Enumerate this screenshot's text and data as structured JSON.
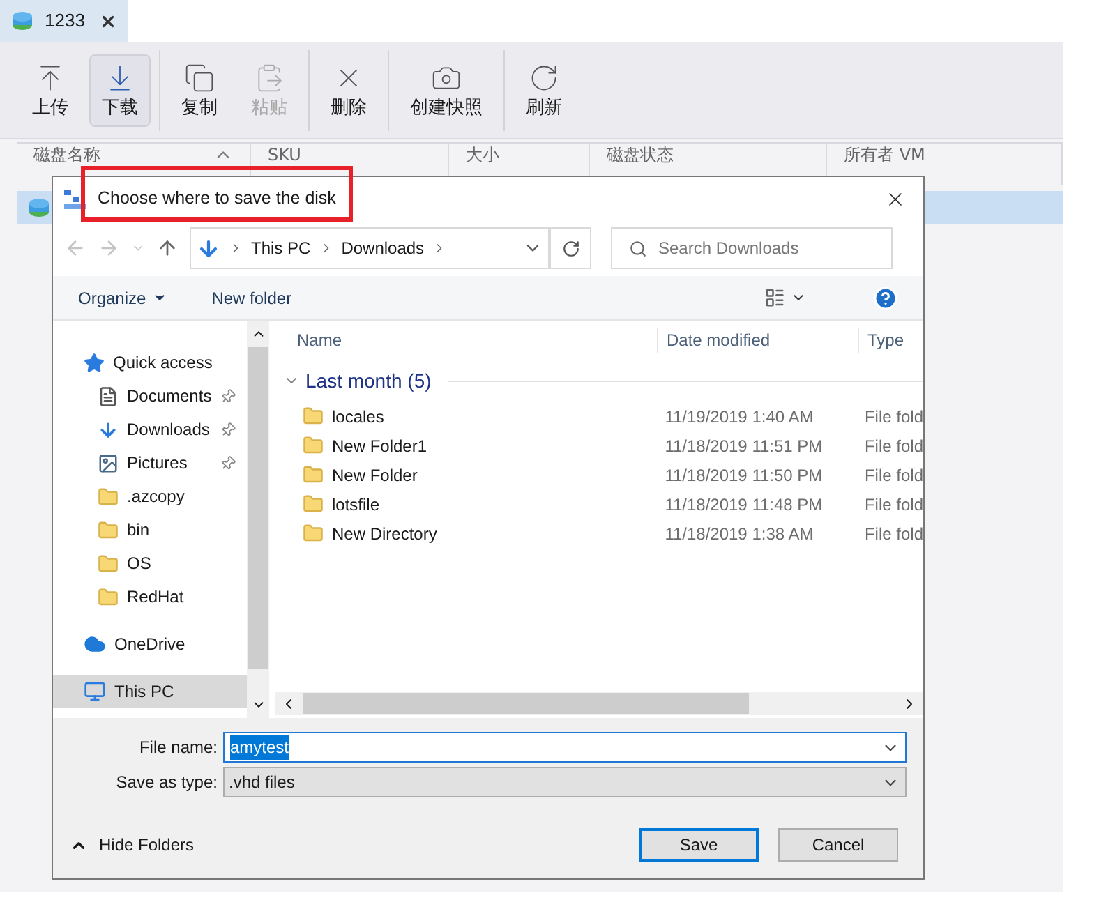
{
  "app": {
    "tab": {
      "title": "1233",
      "selected": true
    },
    "toolbar": [
      {
        "buttons": [
          {
            "kind": "upload",
            "label": "上传",
            "selected": false,
            "disabled": false
          },
          {
            "kind": "download",
            "label": "下载",
            "selected": true,
            "disabled": false
          }
        ]
      },
      {
        "buttons": [
          {
            "kind": "copy",
            "label": "复制",
            "selected": false,
            "disabled": false
          },
          {
            "kind": "paste",
            "label": "粘贴",
            "selected": false,
            "disabled": true
          }
        ]
      },
      {
        "buttons": [
          {
            "kind": "delete",
            "label": "删除",
            "selected": false,
            "disabled": false
          }
        ]
      },
      {
        "buttons": [
          {
            "kind": "snapshot",
            "label": "创建快照",
            "selected": false,
            "disabled": false
          }
        ]
      },
      {
        "buttons": [
          {
            "kind": "refresh",
            "label": "刷新",
            "selected": false,
            "disabled": false
          }
        ]
      }
    ],
    "table": {
      "columns": [
        {
          "label": "磁盘名称",
          "sorted": true
        },
        {
          "label": "SKU",
          "sorted": false
        },
        {
          "label": "大小",
          "sorted": false
        },
        {
          "label": "磁盘状态",
          "sorted": false
        },
        {
          "label": "所有者 VM",
          "sorted": false
        }
      ],
      "rows": [
        {
          "selected": true
        }
      ]
    }
  },
  "dialog": {
    "title": "Choose where to save the disk",
    "highlighted": true,
    "address": {
      "path": [
        "This PC",
        "Downloads"
      ]
    },
    "search": {
      "placeholder": "Search Downloads"
    },
    "commands": {
      "organize": "Organize",
      "new_folder": "New folder"
    },
    "nav": [
      {
        "kind": "quick_access",
        "label": "Quick access",
        "selected": false,
        "children": [
          {
            "kind": "documents",
            "label": "Documents",
            "pinned": true,
            "selected": false
          },
          {
            "kind": "downloads",
            "label": "Downloads",
            "pinned": true,
            "selected": false
          },
          {
            "kind": "pictures",
            "label": "Pictures",
            "pinned": true,
            "selected": false
          },
          {
            "kind": "folder",
            "label": ".azcopy",
            "pinned": false,
            "selected": false
          },
          {
            "kind": "folder",
            "label": "bin",
            "pinned": false,
            "selected": false
          },
          {
            "kind": "folder",
            "label": "OS",
            "pinned": false,
            "selected": false
          },
          {
            "kind": "folder",
            "label": "RedHat",
            "pinned": false,
            "selected": false
          }
        ]
      },
      {
        "kind": "onedrive",
        "label": "OneDrive",
        "selected": false
      },
      {
        "kind": "pc",
        "label": "This PC",
        "selected": true
      }
    ],
    "columns": [
      "Name",
      "Date modified",
      "Type"
    ],
    "groups": [
      {
        "label": "Last month (5)",
        "expanded": true,
        "files": [
          {
            "name": "locales",
            "date": "11/19/2019 1:40 AM",
            "type": "File fold"
          },
          {
            "name": "New Folder1",
            "date": "11/18/2019 11:51 PM",
            "type": "File fold"
          },
          {
            "name": "New Folder",
            "date": "11/18/2019 11:50 PM",
            "type": "File fold"
          },
          {
            "name": "lotsfile",
            "date": "11/18/2019 11:48 PM",
            "type": "File fold"
          },
          {
            "name": "New Directory",
            "date": "11/18/2019 1:38 AM",
            "type": "File fold"
          }
        ]
      }
    ],
    "file_name": {
      "label": "File name:",
      "value": "amytest",
      "text_selected": true
    },
    "save_type": {
      "label": "Save as type:",
      "value": ".vhd files"
    },
    "hide_folders": "Hide Folders",
    "buttons": [
      {
        "label": "Save",
        "default": true
      },
      {
        "label": "Cancel",
        "default": false
      }
    ]
  }
}
